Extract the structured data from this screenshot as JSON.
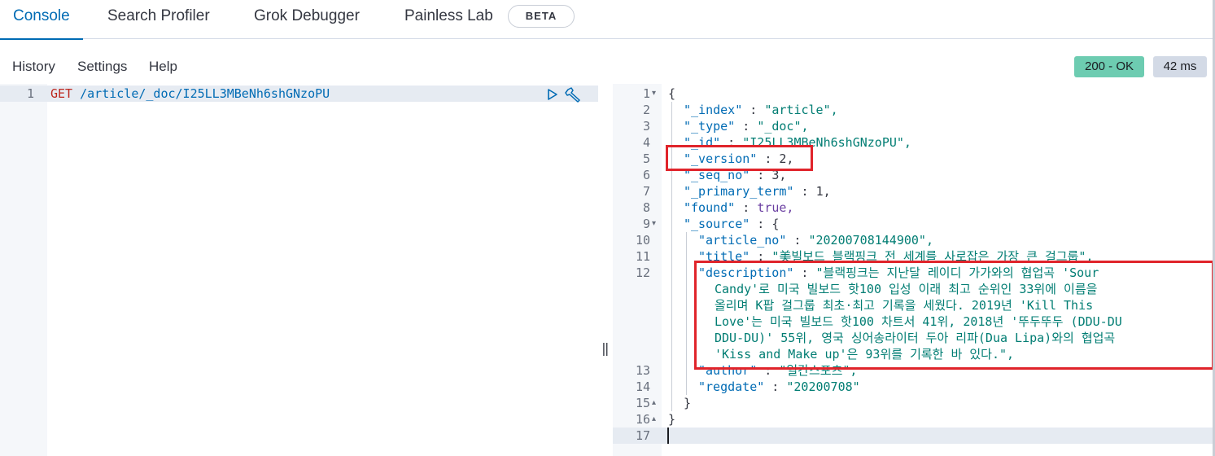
{
  "tabs": [
    {
      "label": "Console",
      "active": true
    },
    {
      "label": "Search Profiler"
    },
    {
      "label": "Grok Debugger"
    },
    {
      "label": "Painless Lab"
    }
  ],
  "beta_badge": "BETA",
  "menu": {
    "history": "History",
    "settings": "Settings",
    "help": "Help"
  },
  "status": {
    "code": "200 - OK",
    "time": "42 ms"
  },
  "request": {
    "line_number": "1",
    "method": "GET",
    "path": "/article/_doc/I25LL3MBeNh6shGNzoPU"
  },
  "response": {
    "lines": [
      {
        "n": "1",
        "text": "{"
      },
      {
        "n": "2",
        "key": "\"_index\"",
        "value": "\"article\","
      },
      {
        "n": "3",
        "key": "\"_type\"",
        "value": "\"_doc\","
      },
      {
        "n": "4",
        "key": "\"_id\"",
        "value": "\"I25LL3MBeNh6shGNzoPU\","
      },
      {
        "n": "5",
        "key": "\"_version\"",
        "value": "2,"
      },
      {
        "n": "6",
        "key": "\"_seq_no\"",
        "value": "3,"
      },
      {
        "n": "7",
        "key": "\"_primary_term\"",
        "value": "1,"
      },
      {
        "n": "8",
        "key": "\"found\"",
        "value": "true,"
      },
      {
        "n": "9",
        "key": "\"_source\"",
        "value": "{"
      },
      {
        "n": "10",
        "key": "\"article_no\"",
        "value": "\"20200708144900\","
      },
      {
        "n": "11",
        "key": "\"title\"",
        "value": "\"美빌보드 블랙핑크 전 세계를 사로잡은 가장 큰 걸그룹\","
      },
      {
        "n": "12",
        "key": "\"description\"",
        "value_lines": [
          "\"블랙핑크는 지난달 레이디 가가와의 협업곡 'Sour",
          "Candy'로 미국 빌보드 핫100 입성 이래 최고 순위인 33위에 이름을",
          "올리며 K팝 걸그룹 최초·최고 기록을 세웠다. 2019년 'Kill This",
          "Love'는 미국 빌보드 핫100 차트서 41위, 2018년 '뚜두뚜두 (DDU-DU",
          "DDU-DU)' 55위, 영국 싱어송라이터 두아 리파(Dua Lipa)와의 협업곡",
          "'Kiss and Make up'은 93위를 기록한 바 있다.\","
        ]
      },
      {
        "n": "13",
        "key": "\"author\"",
        "value": "\"일간스포츠\","
      },
      {
        "n": "14",
        "key": "\"regdate\"",
        "value": "\"20200708\""
      },
      {
        "n": "15",
        "text": "}"
      },
      {
        "n": "16",
        "text": "}"
      },
      {
        "n": "17",
        "text": ""
      }
    ]
  },
  "colors": {
    "accent": "#006bb4",
    "ok": "#6dccb1",
    "highlight": "#e0242b"
  }
}
